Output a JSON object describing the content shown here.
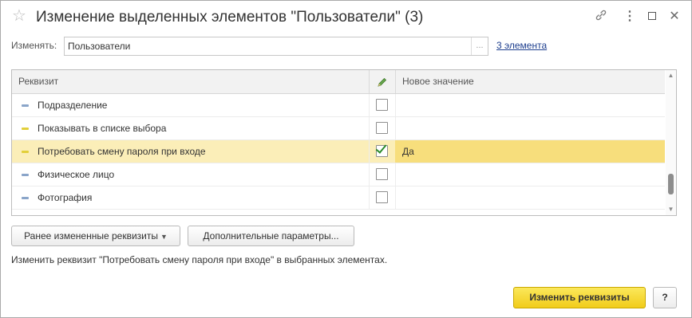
{
  "window": {
    "title": "Изменение выделенных элементов \"Пользователи\" (3)",
    "icons": [
      "star-icon",
      "link-icon",
      "more-icon",
      "maximize-icon",
      "close-icon"
    ]
  },
  "change": {
    "label": "Изменять:",
    "value": "Пользователи",
    "choose_label": "...",
    "count_link": "3 элемента"
  },
  "table": {
    "headers": {
      "rekvizit": "Реквизит",
      "edit_icon": "pencil-icon",
      "new_value": "Новое значение"
    },
    "rows": [
      {
        "name": "Подразделение",
        "marker_color": "#8aa5c9",
        "checked": false,
        "value": ""
      },
      {
        "name": "Показывать в списке выбора",
        "marker_color": "#e2cf3a",
        "checked": false,
        "value": ""
      },
      {
        "name": "Потребовать смену пароля при входе",
        "marker_color": "#e2cf3a",
        "checked": true,
        "value": "Да",
        "selected": true
      },
      {
        "name": "Физическое лицо",
        "marker_color": "#8aa5c9",
        "checked": false,
        "value": ""
      },
      {
        "name": "Фотография",
        "marker_color": "#8aa5c9",
        "checked": false,
        "value": ""
      }
    ]
  },
  "buttons": {
    "previous_changed": "Ранее измененные реквизиты",
    "additional_params": "Дополнительные параметры...",
    "apply": "Изменить реквизиты",
    "help": "?"
  },
  "hint": "Изменить реквизит \"Потребовать смену пароля при входе\" в выбранных элементах.",
  "colors": {
    "selected_row": "#fbeeb8",
    "selected_cell": "#f7de7c",
    "primary_button": "#f5d533",
    "link": "#1d3e8e"
  }
}
